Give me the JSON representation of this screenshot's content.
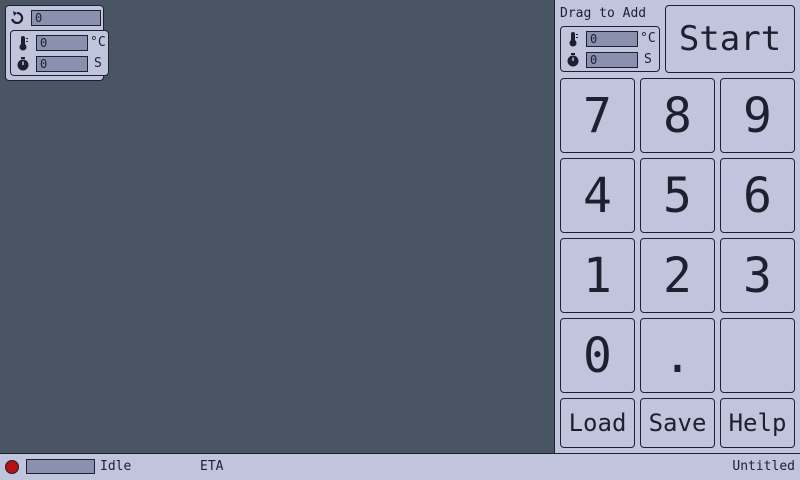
{
  "canvas": {
    "loop_block": {
      "loop_icon": "loop-arrow-icon",
      "loop_count": "0",
      "step": {
        "temperature_icon": "thermometer-icon",
        "temperature_value": "0",
        "temperature_unit": "°C",
        "time_icon": "stopwatch-icon",
        "time_value": "0",
        "time_unit": "S"
      }
    }
  },
  "panel": {
    "drag_label": "Drag to Add",
    "template": {
      "temperature_icon": "thermometer-icon",
      "temperature_value": "0",
      "temperature_unit": "°C",
      "time_icon": "stopwatch-icon",
      "time_value": "0",
      "time_unit": "S"
    },
    "start_label": "Start",
    "keys": [
      "7",
      "8",
      "9",
      "4",
      "5",
      "6",
      "1",
      "2",
      "3",
      "0",
      ".",
      ""
    ],
    "load_label": "Load",
    "save_label": "Save",
    "help_label": "Help"
  },
  "status": {
    "led_color": "#b80f14",
    "progress": 0,
    "state": "Idle",
    "eta_label": "ETA",
    "filename": "Untitled"
  }
}
